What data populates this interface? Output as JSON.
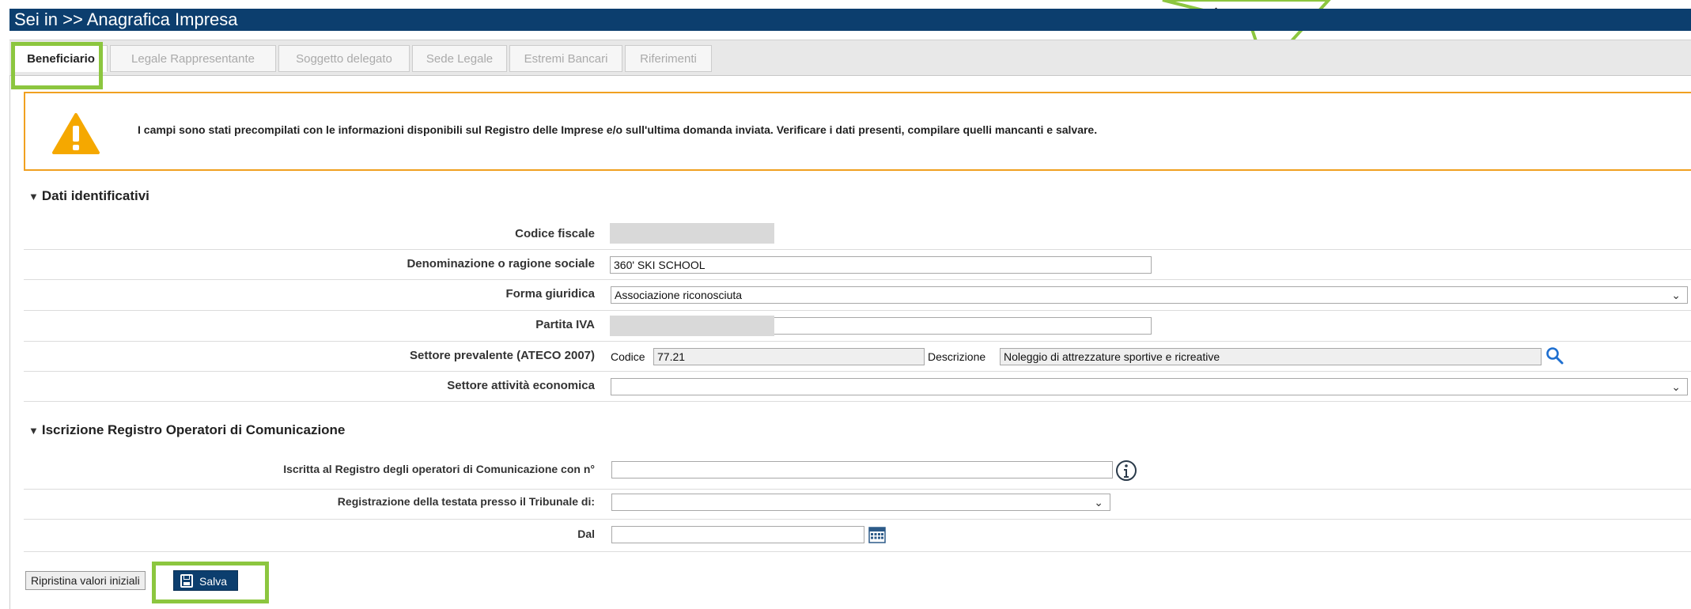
{
  "header": {
    "title": "Sei in >> Anagrafica Impresa"
  },
  "tabs": [
    {
      "label": "Beneficiario",
      "active": true
    },
    {
      "label": "Legale Rappresentante",
      "active": false
    },
    {
      "label": "Soggetto delegato",
      "active": false
    },
    {
      "label": "Sede Legale",
      "active": false
    },
    {
      "label": "Estremi Bancari",
      "active": false
    },
    {
      "label": "Riferimenti",
      "active": false
    }
  ],
  "warning": {
    "icon": "warning-icon",
    "text": "I campi sono stati precompilati con le informazioni disponibili sul Registro delle Imprese e/o sull'ultima domanda inviata. Verificare i dati presenti, compilare quelli mancanti e salvare."
  },
  "section1": {
    "title": "Dati identificativi",
    "codice_fiscale": {
      "label": "Codice fiscale",
      "value": ""
    },
    "denominazione": {
      "label": "Denominazione o ragione sociale",
      "value": "360' SKI SCHOOL"
    },
    "forma_giuridica": {
      "label": "Forma giuridica",
      "value": "Associazione riconosciuta"
    },
    "partita_iva": {
      "label": "Partita IVA",
      "value": ""
    },
    "settore_prevalente": {
      "label": "Settore prevalente (ATECO 2007)",
      "codice_label": "Codice",
      "codice_value": "77.21",
      "descrizione_label": "Descrizione",
      "descrizione_value": "Noleggio di attrezzature sportive e ricreative"
    },
    "settore_attivita": {
      "label": "Settore attività economica",
      "value": ""
    }
  },
  "section2": {
    "title": "Iscrizione Registro Operatori di Comunicazione",
    "iscritta": {
      "label": "Iscritta al Registro degli operatori di Comunicazione con n°",
      "value": ""
    },
    "registrazione": {
      "label": "Registrazione della testata presso il Tribunale di:",
      "value": ""
    },
    "dal": {
      "label": "Dal",
      "value": ""
    }
  },
  "buttons": {
    "reset_label": "Ripristina valori iniziali",
    "save_label": "Salva"
  },
  "colors": {
    "header": "#0c3e6e",
    "highlight": "#8cc63f",
    "warning_border": "#f0a020"
  }
}
